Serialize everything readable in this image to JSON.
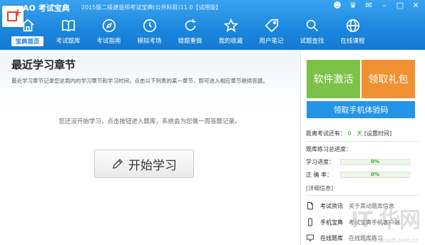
{
  "app": {
    "brand": "AO 考试宝典",
    "title": "2015版二级建造师考试宝典(公共科目)11.0【试用版】"
  },
  "top_icons": [
    "user-icon",
    "shirt-icon",
    "message-icon",
    "minus-icon",
    "maximize-icon",
    "close-icon"
  ],
  "nav": [
    {
      "label": "宝典首页",
      "icon": "home-icon",
      "active": true
    },
    {
      "label": "考试题库",
      "icon": "book-icon"
    },
    {
      "label": "考试指南",
      "icon": "compass-icon"
    },
    {
      "label": "模拟考场",
      "icon": "clock-icon"
    },
    {
      "label": "错题重做",
      "icon": "refresh-icon"
    },
    {
      "label": "我的收藏",
      "icon": "star-icon"
    },
    {
      "label": "用户笔记",
      "icon": "tag-icon"
    },
    {
      "label": "试题查找",
      "icon": "search-icon"
    },
    {
      "label": "在线课程",
      "icon": "globe-icon"
    }
  ],
  "main": {
    "heading": "最近学习章节",
    "description": "最近学习章节记录您这周内的学习章节和学习时间，点击以下列表的某一章节，即可进入相应章节继续答题。",
    "empty_message": "您还没开始学习，点击按钮进入题库，系统会为您做一周答题记录。",
    "start_button": "开始学习"
  },
  "side": {
    "activate_button": "软件激活",
    "gift_button": "领取礼包",
    "phone_code_button": "领取手机体验码",
    "exam_countdown_prefix": "距离考试还有：",
    "exam_countdown_value": "0",
    "exam_countdown_unit": "天",
    "set_time_link": "[设置时间]",
    "progress_title": "题库练习总进度：",
    "study_progress_label": "学习进度：",
    "study_progress_value": "0%",
    "accuracy_label": "正 确 率：",
    "accuracy_value": "0%",
    "details_link": "[详细信息]",
    "links": [
      {
        "title": "考试资讯",
        "desc": "关于其动题库信息",
        "icon": "document-icon"
      },
      {
        "title": "手机宝典",
        "desc": "考试宝典手机客户端",
        "icon": "phone-icon"
      },
      {
        "title": "在线题库",
        "desc": "在线题库练习",
        "icon": "monitor-icon"
      }
    ]
  },
  "watermark": {
    "text": "IT 华网",
    "subtext": "www.pcsoft.com.cn"
  },
  "colors": {
    "primary": "#1b86dd",
    "green": "#7dc248",
    "orange": "#f19232",
    "blue_button": "#2495e6"
  }
}
